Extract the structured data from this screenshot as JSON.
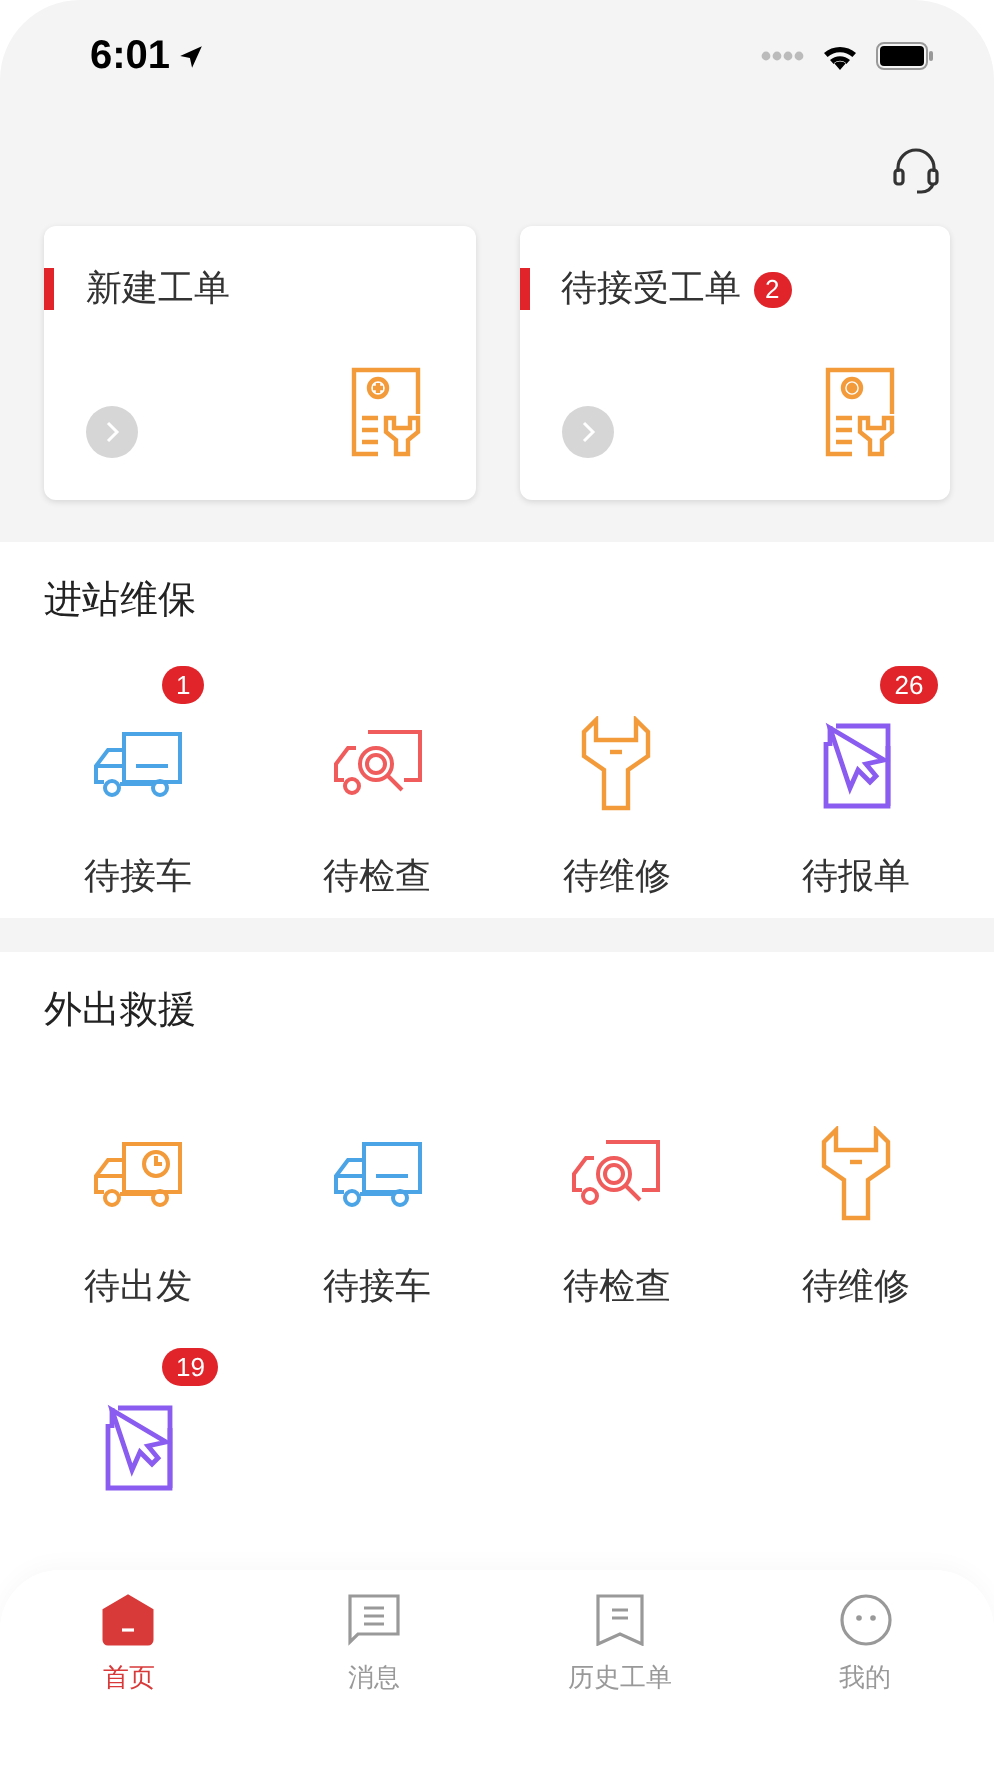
{
  "status_bar": {
    "time": "6:01"
  },
  "cards": [
    {
      "title": "新建工单"
    },
    {
      "title": "待接受工单",
      "badge": "2"
    }
  ],
  "sections": [
    {
      "title": "进站维保",
      "items": [
        {
          "label": "待接车",
          "kind": "truck",
          "badge": "1"
        },
        {
          "label": "待检查",
          "kind": "inspect"
        },
        {
          "label": "待维修",
          "kind": "wrench"
        },
        {
          "label": "待报单",
          "kind": "report",
          "badge": "26"
        }
      ]
    },
    {
      "title": "外出救援",
      "items": [
        {
          "label": "待出发",
          "kind": "depart"
        },
        {
          "label": "待接车",
          "kind": "truck"
        },
        {
          "label": "待检查",
          "kind": "inspect"
        },
        {
          "label": "待维修",
          "kind": "wrench"
        },
        {
          "kind": "report",
          "badge": "19"
        }
      ]
    }
  ],
  "tab_bar": [
    {
      "label": "首页",
      "selected": true
    },
    {
      "label": "消息",
      "selected": false
    },
    {
      "label": "历史工单",
      "selected": false
    },
    {
      "label": "我的",
      "selected": false
    }
  ]
}
